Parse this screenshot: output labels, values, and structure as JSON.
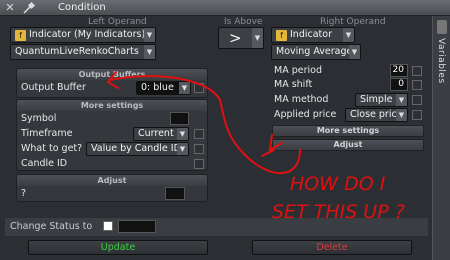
{
  "window": {
    "title": "Condition",
    "side_tab": "Variables"
  },
  "headers": {
    "left": "Left Operand",
    "middle": "Is Above",
    "right": "Right Operand"
  },
  "left": {
    "type_select": "Indicator (My Indicators)",
    "indicator_select": "QuantumLiveRenkoCharts",
    "output_buffers_title": "Output Buffers",
    "output_buffer_label": "Output Buffer",
    "output_buffer_value": "0: blue",
    "more_settings_title": "More settings",
    "symbol_label": "Symbol",
    "timeframe_label": "Timeframe",
    "timeframe_value": "Current",
    "what_label": "What to get?",
    "what_value": "Value by Candle ID",
    "candle_label": "Candle ID",
    "adjust_title": "Adjust",
    "adjust_value": "?"
  },
  "operator": {
    "value": ">"
  },
  "right": {
    "type_select": "Indicator",
    "indicator_select": "Moving Average",
    "ma_period_label": "MA period",
    "ma_period_value": "20",
    "ma_shift_label": "MA shift",
    "ma_shift_value": "0",
    "ma_method_label": "MA method",
    "ma_method_value": "Simple",
    "applied_price_label": "Applied price",
    "applied_price_value": "Close price",
    "more_settings_label": "More settings",
    "adjust_label": "Adjust"
  },
  "footer": {
    "change_status_label": "Change Status to",
    "update_label": "Update",
    "delete_label": "Delete"
  },
  "annotation": {
    "text_line1": "HOW DO I",
    "text_line2": "SET THIS UP ?"
  },
  "colors": {
    "update": "#3fd13f",
    "delete": "#e03a3a",
    "annotation": "#e01010",
    "indicator_icon": "#e3b737"
  }
}
